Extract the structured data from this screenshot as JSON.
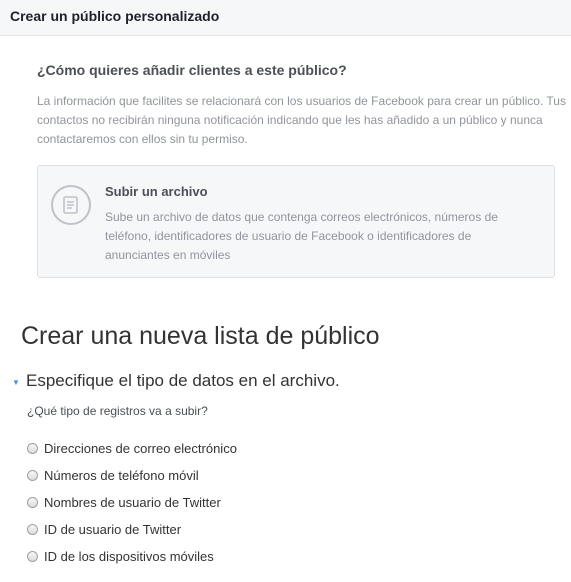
{
  "header": {
    "title": "Crear un público personalizado"
  },
  "intro": {
    "question": "¿Cómo quieres añadir clientes a este público?",
    "info": "La información que facilites se relacionará con los usuarios de Facebook para crear un público. Tus contactos no recibirán ninguna notificación indicando que les has añadido a un público y nunca contactaremos con ellos sin tu permiso."
  },
  "upload_card": {
    "icon": "document-list-icon",
    "title": "Subir un archivo",
    "description": "Sube un archivo de datos que contenga correos electrónicos, números de teléfono, identificadores de usuario de Facebook o identificadores de anunciantes en móviles"
  },
  "new_list": {
    "heading": "Crear una nueva lista de público",
    "subheading": "Especifique el tipo de datos en el archivo.",
    "prompt": "¿Qué tipo de registros va a subir?",
    "options": [
      "Direcciones de correo electrónico",
      "Números de teléfono móvil",
      "Nombres de usuario de Twitter",
      "ID de usuario de Twitter",
      "ID de los dispositivos móviles"
    ]
  },
  "colors": {
    "accent": "#4a90e2",
    "header_bg": "#f6f7f9",
    "muted_text": "#90949c"
  }
}
